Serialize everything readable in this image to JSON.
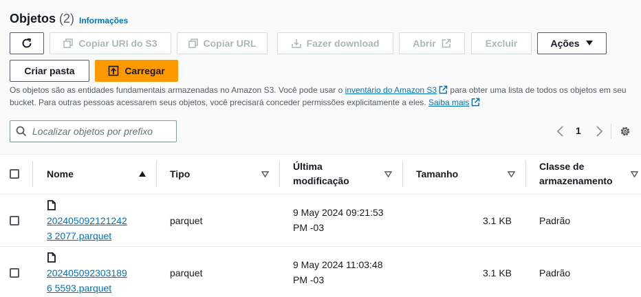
{
  "header": {
    "title": "Objetos",
    "count": "(2)",
    "info_link": "Informações"
  },
  "toolbar": {
    "refresh_icon": "refresh-icon",
    "copy_s3_uri": "Copiar URI do S3",
    "copy_url": "Copiar URL",
    "download": "Fazer download",
    "open": "Abrir",
    "delete": "Excluir",
    "actions": "Ações",
    "create_folder": "Criar pasta",
    "upload": "Carregar"
  },
  "description": {
    "part1": "Os objetos são as entidades fundamentais armazenadas no Amazon S3. Você pode usar o ",
    "inventory_link": "inventário do Amazon S3",
    "part2": " para obter uma lista de todos os objetos em seu bucket. Para outras pessoas acessarem seus objetos, você precisará conceder permissões explicitamente a eles. ",
    "learn_more_link": "Saiba mais"
  },
  "search": {
    "placeholder": "Localizar objetos por prefixo",
    "value": ""
  },
  "pagination": {
    "current_page": "1"
  },
  "table": {
    "headers": {
      "name": "Nome",
      "type": "Tipo",
      "modified_line1": "Última",
      "modified_line2": "modificação",
      "size": "Tamanho",
      "class_line1": "Classe de",
      "class_line2": "armazenamento"
    },
    "rows": [
      {
        "name_line1": "202405092121242",
        "name_line2": "3 2077.parquet",
        "type": "parquet",
        "modified_line1": "9 May 2024 09:21:53",
        "modified_line2": "PM -03",
        "size": "3.1 KB",
        "storage_class": "Padrão"
      },
      {
        "name_line1": "202405092303189",
        "name_line2": "6 5593.parquet",
        "type": "parquet",
        "modified_line1": "9 May 2024 11:03:48",
        "modified_line2": "PM -03",
        "size": "3.1 KB",
        "storage_class": "Padrão"
      }
    ]
  },
  "colors": {
    "accent": "#ff9900",
    "link": "#0073bb",
    "text": "#16191f",
    "muted": "#545b64",
    "disabled": "#aab7b8"
  }
}
